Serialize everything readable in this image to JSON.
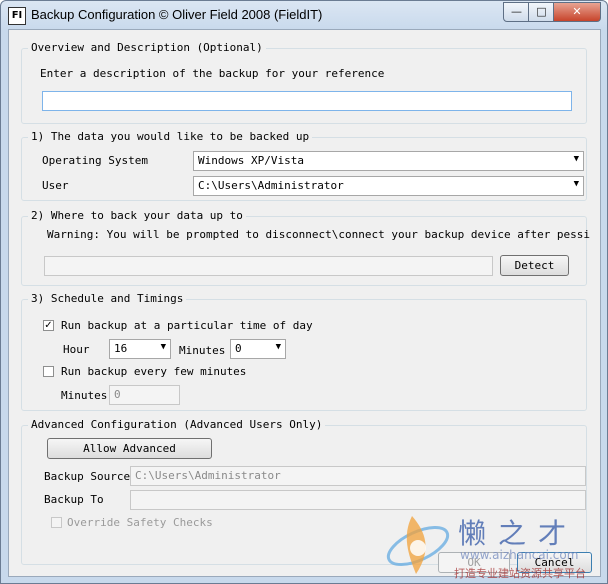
{
  "window": {
    "title": "Backup Configuration © Oliver Field 2008 (FieldIT)",
    "app_icon": "FI",
    "controls": {
      "minimize": "—",
      "maximize": "□",
      "close": "✕"
    }
  },
  "overview": {
    "legend": "Overview and Description (Optional)",
    "prompt": "Enter a description of the backup for your reference",
    "description_value": ""
  },
  "data_section": {
    "legend": "1) The data you would like to be backed up",
    "os_label": "Operating System",
    "os_value": "Windows XP/Vista",
    "user_label": "User",
    "user_value": "C:\\Users\\Administrator"
  },
  "destination": {
    "legend": "2) Where to back your data up to",
    "warning": "Warning: You will be prompted to disconnect\\connect your backup device after pessing Detect",
    "path_value": "",
    "detect_label": "Detect"
  },
  "schedule": {
    "legend": "3) Schedule and Timings",
    "run_time_label": "Run backup at a particular time of day",
    "run_time_checked": true,
    "hour_label": "Hour",
    "hour_value": "16",
    "minutes_label": "Minutes",
    "minutes_value": "0",
    "run_every_label": "Run backup every few minutes",
    "run_every_checked": false,
    "every_minutes_label": "Minutes",
    "every_minutes_value": "0"
  },
  "advanced": {
    "legend": "Advanced Configuration (Advanced Users Only)",
    "allow_label": "Allow Advanced",
    "source_label": "Backup Source",
    "source_value": "C:\\Users\\Administrator",
    "to_label": "Backup To",
    "to_value": "",
    "override_label": "Override Safety Checks"
  },
  "footer": {
    "ok_label": "OK",
    "cancel_label": "Cancel"
  },
  "watermark": {
    "brand": "懒之才",
    "url": "www.aizhancai.com",
    "tagline": "打造专业建站资源共享平台"
  },
  "colors": {
    "titlebar": "#c8d9ec",
    "close_button": "#c7442b",
    "dialog_bg": "#f0f0f0",
    "focus_border": "#7eb4ea"
  }
}
